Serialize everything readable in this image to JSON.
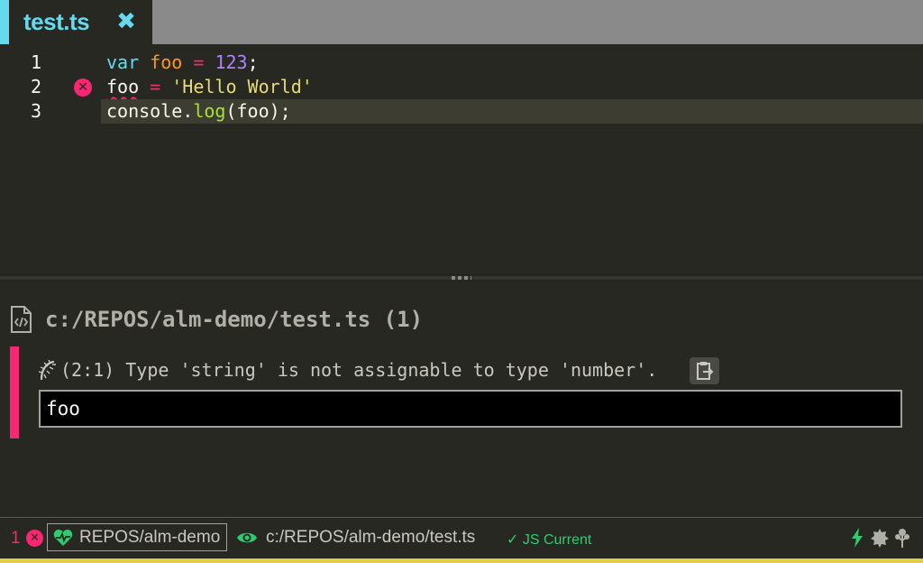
{
  "tab": {
    "title": "test.ts",
    "close_glyph": "✖",
    "accent_color": "#66d9ef"
  },
  "editor": {
    "lines": [
      {
        "number": "1",
        "tokens": [
          {
            "text": "var",
            "type": "kw"
          },
          {
            "text": " ",
            "type": "plain"
          },
          {
            "text": "foo",
            "type": "var"
          },
          {
            "text": " ",
            "type": "plain"
          },
          {
            "text": "=",
            "type": "op"
          },
          {
            "text": " ",
            "type": "plain"
          },
          {
            "text": "123",
            "type": "num"
          },
          {
            "text": ";",
            "type": "plain"
          }
        ]
      },
      {
        "number": "2",
        "has_error": true,
        "tokens": [
          {
            "text": "foo",
            "type": "squiggle"
          },
          {
            "text": " ",
            "type": "plain"
          },
          {
            "text": "=",
            "type": "op"
          },
          {
            "text": " ",
            "type": "plain"
          },
          {
            "text": "'Hello World'",
            "type": "str"
          }
        ]
      },
      {
        "number": "3",
        "current": true,
        "tokens": [
          {
            "text": "console.",
            "type": "plain"
          },
          {
            "text": "log",
            "type": "fn"
          },
          {
            "text": "(foo);",
            "type": "plain"
          }
        ]
      }
    ]
  },
  "errors_panel": {
    "file_path": "c:/REPOS/alm-demo/test.ts (1)",
    "file_icon": "code-file-icon",
    "error": {
      "location": "(2:1)",
      "message": " Type 'string' is not assignable to type 'number'.",
      "icon": "bug-icon",
      "copy_icon": "clipboard-icon",
      "preview": "foo",
      "bar_color": "#f92672"
    }
  },
  "status_bar": {
    "error_count": "1",
    "project": "REPOS/alm-demo",
    "file_path": "c:/REPOS/alm-demo/test.ts",
    "js_status": "✓ JS Current",
    "icons": [
      "heartbeat-icon",
      "eye-icon",
      "bolt-icon",
      "badge-icon",
      "tree-icon"
    ],
    "colors": {
      "error": "#f92672",
      "success": "#2ecc71",
      "bottom_border": "#e6c84a"
    }
  }
}
